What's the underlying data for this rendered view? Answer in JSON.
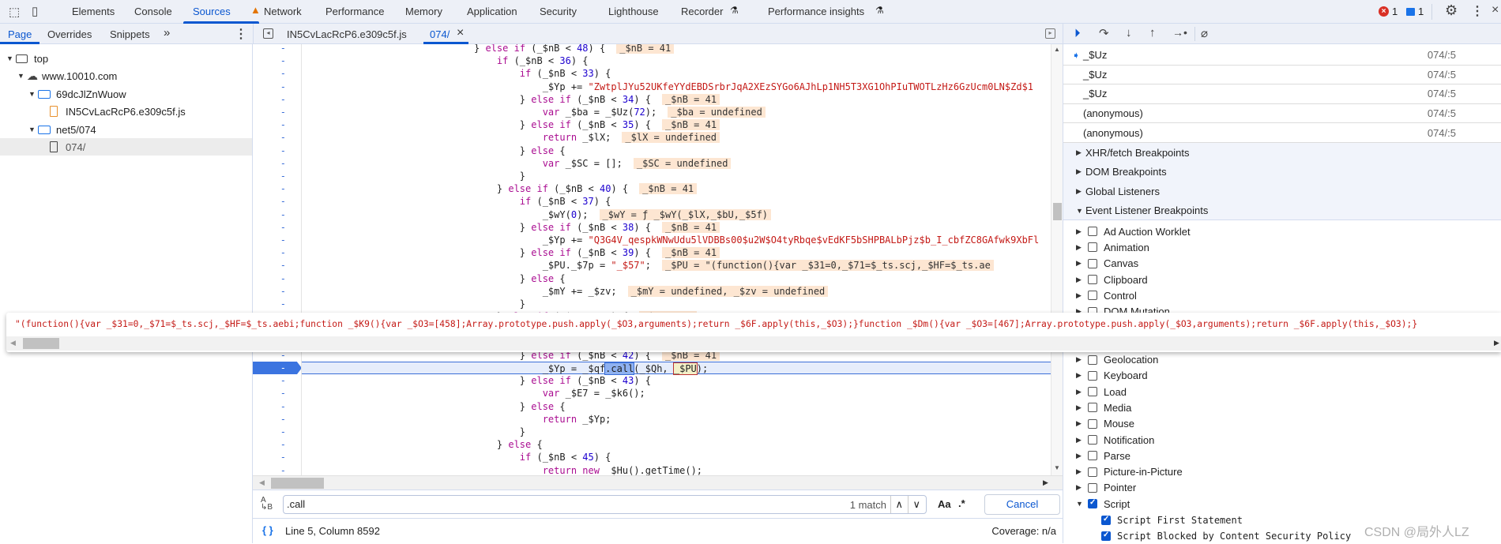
{
  "main_tabs": [
    "Elements",
    "Console",
    "Sources",
    "Network",
    "Performance",
    "Memory",
    "Application",
    "Security",
    "Lighthouse",
    "Recorder",
    "Performance insights"
  ],
  "active_main_tab": "Sources",
  "status_counts": {
    "errors": "1",
    "messages": "1"
  },
  "navigator": {
    "tabs": [
      "Page",
      "Overrides",
      "Snippets"
    ],
    "more": "»",
    "tree": [
      {
        "label": "top",
        "icon": "frame-icon"
      },
      {
        "label": "www.10010.com",
        "icon": "cloud-icon"
      },
      {
        "label": "69dcJlZnWuow",
        "icon": "folder-icon"
      },
      {
        "label": "IN5CvLacRcP6.e309c5f.js",
        "icon": "js-file-icon"
      },
      {
        "label": "net5/074",
        "icon": "folder-icon"
      },
      {
        "label": "074/",
        "icon": "document-icon"
      }
    ]
  },
  "editor": {
    "tabs": [
      {
        "label": "IN5CvLacRcP6.e309c5f.js"
      },
      {
        "label": "074/",
        "close": "×"
      }
    ],
    "gutter_mark": "-",
    "lines": [
      {
        "text": "} else if (_$nB < 48) {",
        "value": "_$nB = 41"
      },
      {
        "text": "    if (_$nB < 36) {"
      },
      {
        "text": "        if (_$nB < 33) {"
      },
      {
        "text": "            _$Yp += \"ZwtplJYu52UKfeYYdEBDSrbrJqA2XEzSYGo6AJhLp1NH5T3XG1OhPIuTWOTLzHz6GzUcm0LN$Zd$1"
      },
      {
        "text": "        } else if (_$nB < 34) {",
        "value": "_$nB = 41"
      },
      {
        "text": "            var _$ba = _$Uz(72);",
        "value": "_$ba = undefined"
      },
      {
        "text": "        } else if (_$nB < 35) {",
        "value": "_$nB = 41"
      },
      {
        "text": "            return _$lX;",
        "value": "_$lX = undefined"
      },
      {
        "text": "        } else {"
      },
      {
        "text": "            var _$SC = [];",
        "value": "_$SC = undefined"
      },
      {
        "text": "        }"
      },
      {
        "text": "    } else if (_$nB < 40) {",
        "value": "_$nB = 41"
      },
      {
        "text": "        if (_$nB < 37) {"
      },
      {
        "text": "            _$wY(0);",
        "value": "_$wY = ƒ _$wY(_$lX,_$bU,_$5f)"
      },
      {
        "text": "        } else if (_$nB < 38) {",
        "value": "_$nB = 41"
      },
      {
        "text": "            _$Yp += \"Q3G4V_qespkWNwUdu5lVDBBs00$u2W$O4tyRbqe$vEdKF5bSHPBALbPjz$b_I_cbfZC8GAfwk9XbFl"
      },
      {
        "text": "        } else if (_$nB < 39) {",
        "value": "_$nB = 41"
      },
      {
        "text": "            _$PU._$7p = \"_$57\";",
        "value": "_$PU = \"(function(){var _$31=0,_$71=$_ts.scj,_$HF=$_ts.ae"
      },
      {
        "text": "        } else {"
      },
      {
        "text": "            _$mY += _$zv;",
        "value": "_$mY = undefined, _$zv = undefined"
      },
      {
        "text": "        }"
      },
      {
        "text": "    } else if (_$nB < 44) {",
        "value": "_$nB = 41"
      },
      {
        "text": ""
      },
      {
        "text": ""
      },
      {
        "text": "        } else if (_$nB < 42) {",
        "value": "_$nB = 41"
      },
      {
        "text": "            _$Yp = _$qf.call(_$Qh, _$PU);",
        "current": true,
        "hover_token": "_$PU"
      },
      {
        "text": "        } else if (_$nB < 43) {"
      },
      {
        "text": "            var _$E7 = _$k6();"
      },
      {
        "text": "        } else {"
      },
      {
        "text": "            return _$Yp;"
      },
      {
        "text": "        }"
      },
      {
        "text": "    } else {"
      },
      {
        "text": "        if (_$nB < 45) {"
      },
      {
        "text": "            return new _$Hu().getTime();"
      }
    ],
    "tooltip": "\"(function(){var _$31=0,_$71=$_ts.scj,_$HF=$_ts.aebi;function _$K9(){var _$O3=[458];Array.prototype.push.apply(_$O3,arguments);return _$6F.apply(this,_$O3);}function _$Dm(){var _$O3=[467];Array.prototype.push.apply(_$O3,arguments);return _$6F.apply(this,_$O3);}"
  },
  "search": {
    "value": ".call",
    "match_count": "1 match",
    "case_label": "Aa",
    "regex_label": ".*",
    "cancel_label": "Cancel"
  },
  "statusbar": {
    "position": "Line 5, Column 8592",
    "coverage": "Coverage: n/a"
  },
  "debugger": {
    "call_stack": [
      {
        "name": "_$Uz",
        "location": "074/:5",
        "current": true
      },
      {
        "name": "_$Uz",
        "location": "074/:5"
      },
      {
        "name": "_$Uz",
        "location": "074/:5"
      },
      {
        "name": "(anonymous)",
        "location": "074/:5"
      },
      {
        "name": "(anonymous)",
        "location": "074/:5"
      }
    ],
    "sections": [
      {
        "label": "XHR/fetch Breakpoints",
        "expanded": false
      },
      {
        "label": "DOM Breakpoints",
        "expanded": false
      },
      {
        "label": "Global Listeners",
        "expanded": false
      },
      {
        "label": "Event Listener Breakpoints",
        "expanded": true
      }
    ],
    "event_categories": [
      {
        "label": "Ad Auction Worklet",
        "checked": false
      },
      {
        "label": "Animation",
        "checked": false
      },
      {
        "label": "Canvas",
        "checked": false
      },
      {
        "label": "Clipboard",
        "checked": false
      },
      {
        "label": "Control",
        "checked": false
      },
      {
        "label": "DOM Mutation",
        "checked": false
      },
      {
        "label": "Geolocation",
        "checked": false
      },
      {
        "label": "Keyboard",
        "checked": false
      },
      {
        "label": "Load",
        "checked": false
      },
      {
        "label": "Media",
        "checked": false
      },
      {
        "label": "Mouse",
        "checked": false
      },
      {
        "label": "Notification",
        "checked": false
      },
      {
        "label": "Parse",
        "checked": false
      },
      {
        "label": "Picture-in-Picture",
        "checked": false
      },
      {
        "label": "Pointer",
        "checked": false
      },
      {
        "label": "Script",
        "checked": true,
        "expanded": true
      }
    ],
    "script_children": [
      {
        "label": "Script First Statement",
        "checked": true
      },
      {
        "label": "Script Blocked by Content Security Policy",
        "checked": true
      }
    ]
  },
  "colors": {
    "accent": "#0b57d0",
    "keyword": "#aa0d91",
    "number": "#1c00cf",
    "string": "#c41a16",
    "inline_value_bg": "#fde6d2",
    "error": "#d93025"
  },
  "watermark": "CSDN @局外人LZ"
}
